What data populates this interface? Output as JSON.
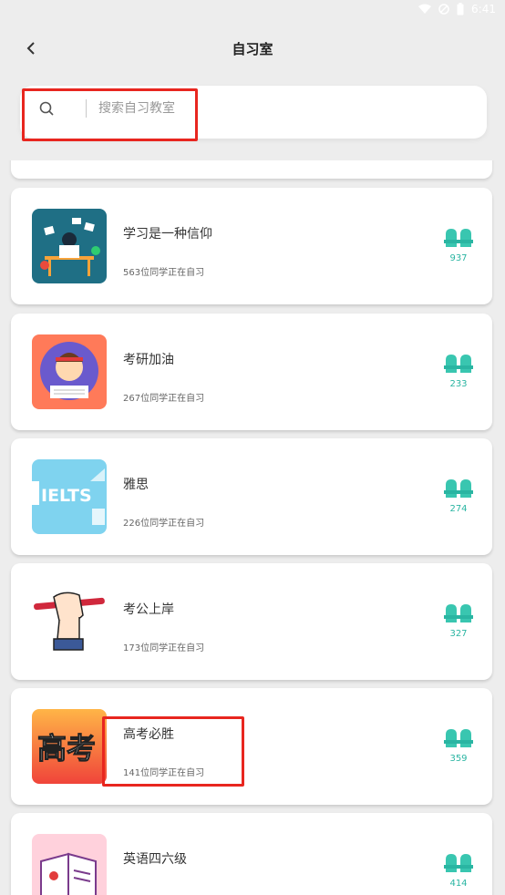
{
  "status_bar": {
    "time": "6:41"
  },
  "header": {
    "title": "自习室",
    "back_icon": "chevron-left-icon"
  },
  "search": {
    "placeholder": "搜索自习教室",
    "icon": "search-icon"
  },
  "rooms": [
    {
      "name": "学习是一种信仰",
      "count_text": "563位同学正在自习",
      "seats": "937",
      "thumb_color": "#1f6f85"
    },
    {
      "name": "考研加油",
      "count_text": "267位同学正在自习",
      "seats": "233",
      "thumb_color": "#ff9a3c"
    },
    {
      "name": "雅思",
      "count_text": "226位同学正在自习",
      "seats": "274",
      "thumb_color": "#7fd3ef"
    },
    {
      "name": "考公上岸",
      "count_text": "173位同学正在自习",
      "seats": "327",
      "thumb_color": "#ffffff"
    },
    {
      "name": "高考必胜",
      "count_text": "141位同学正在自习",
      "seats": "359",
      "thumb_color": "#f0543a"
    },
    {
      "name": "英语四六级",
      "count_text": "",
      "seats": "414",
      "thumb_color": "#ffd1dc"
    }
  ],
  "thumb_text": {
    "ielts": "IELTS",
    "gaokao": "高考"
  },
  "colors": {
    "accent": "#2ab5a2",
    "highlight": "#e8261f",
    "background": "#ededed"
  }
}
